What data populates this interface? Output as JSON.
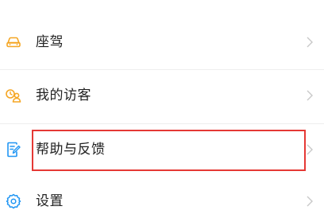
{
  "menu": {
    "items": [
      {
        "label": "座驾",
        "icon": "car-icon",
        "color": "#f5a623"
      },
      {
        "label": "我的访客",
        "icon": "visitors-icon",
        "color": "#f5a623"
      },
      {
        "label": "帮助与反馈",
        "icon": "feedback-icon",
        "color": "#2196f3"
      },
      {
        "label": "设置",
        "icon": "gear-icon",
        "color": "#2196f3"
      }
    ],
    "chevron_color": "#c8c8c8",
    "highlight_color": "#e53935"
  }
}
